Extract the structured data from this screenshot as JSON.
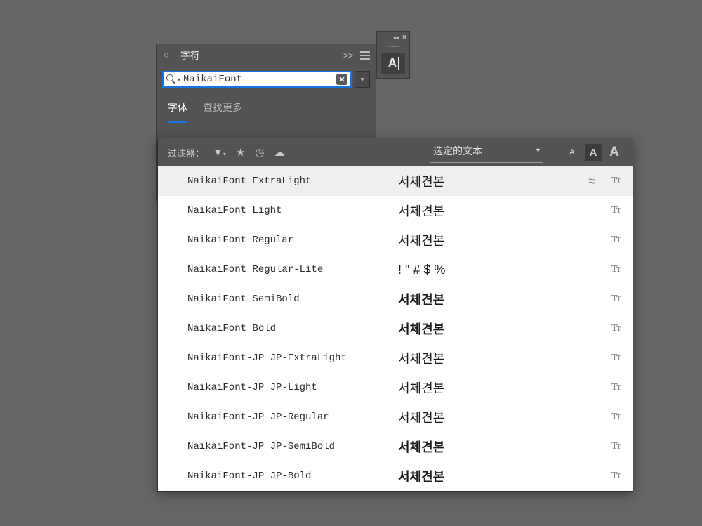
{
  "panel": {
    "title": "字符",
    "collapse": ">>",
    "search_value": "NaikaiFont",
    "subtabs": {
      "fonts": "字体",
      "find_more": "查找更多"
    }
  },
  "mini_tool": {
    "label": "A"
  },
  "flyout": {
    "filter_label": "过滤器：",
    "preview_mode": "选定的文本",
    "size_small": "A",
    "size_med": "A",
    "size_large": "A",
    "fonts": [
      {
        "name": "NaikaiFont ExtraLight",
        "preview": "서체견본",
        "weight": "extralight",
        "approx": true
      },
      {
        "name": "NaikaiFont Light",
        "preview": "서체견본",
        "weight": "light",
        "approx": false
      },
      {
        "name": "NaikaiFont Regular",
        "preview": "서체견본",
        "weight": "normal",
        "approx": false
      },
      {
        "name": "NaikaiFont Regular-Lite",
        "preview": "! \" # $ %",
        "weight": "normal",
        "approx": false
      },
      {
        "name": "NaikaiFont SemiBold",
        "preview": "서체견본",
        "weight": "semibold",
        "approx": false
      },
      {
        "name": "NaikaiFont Bold",
        "preview": "서체견본",
        "weight": "bold",
        "approx": false
      },
      {
        "name": "NaikaiFont-JP JP-ExtraLight",
        "preview": "서체견본",
        "weight": "extralight",
        "approx": false
      },
      {
        "name": "NaikaiFont-JP JP-Light",
        "preview": "서체견본",
        "weight": "light",
        "approx": false
      },
      {
        "name": "NaikaiFont-JP JP-Regular",
        "preview": "서체견본",
        "weight": "normal",
        "approx": false
      },
      {
        "name": "NaikaiFont-JP JP-SemiBold",
        "preview": "서체견본",
        "weight": "semibold",
        "approx": false
      },
      {
        "name": "NaikaiFont-JP JP-Bold",
        "preview": "서체견본",
        "weight": "bold",
        "approx": false
      }
    ]
  },
  "icons": {
    "approx": "≈",
    "tt": "Tr"
  }
}
